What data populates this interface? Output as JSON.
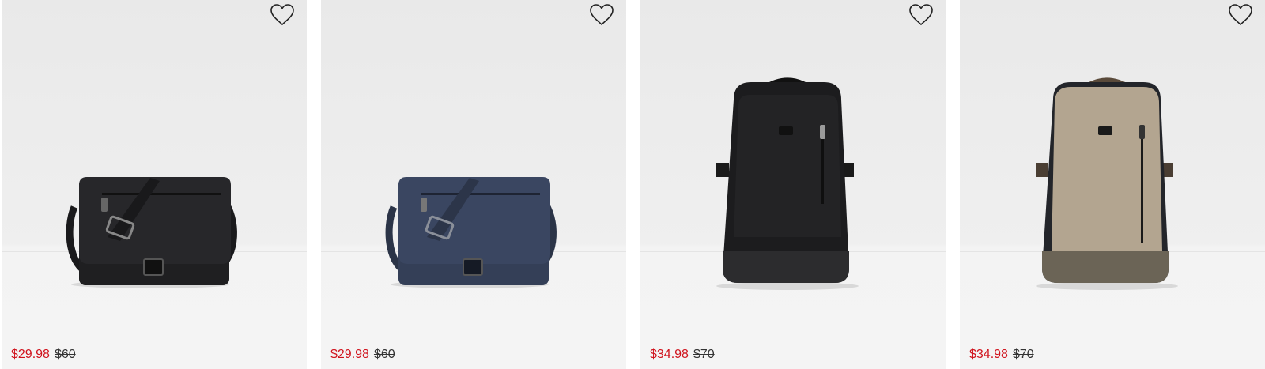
{
  "colors": {
    "sale_price": "#d0121c",
    "original_price": "#333333",
    "card_background": "#ececec"
  },
  "products": [
    {
      "kind": "messenger-bag",
      "color_name": "black",
      "main_color": "#1f1f21",
      "sale_price": "$29.98",
      "original_price": "$60",
      "wishlist_icon": "heart-outline-icon"
    },
    {
      "kind": "messenger-bag",
      "color_name": "navy",
      "main_color": "#343f57",
      "sale_price": "$29.98",
      "original_price": "$60",
      "wishlist_icon": "heart-outline-icon"
    },
    {
      "kind": "backpack",
      "color_name": "black",
      "main_color": "#1c1c1e",
      "sale_price": "$34.98",
      "original_price": "$70",
      "wishlist_icon": "heart-outline-icon"
    },
    {
      "kind": "backpack",
      "color_name": "taupe",
      "main_color": "#b3a590",
      "sale_price": "$34.98",
      "original_price": "$70",
      "wishlist_icon": "heart-outline-icon"
    }
  ]
}
